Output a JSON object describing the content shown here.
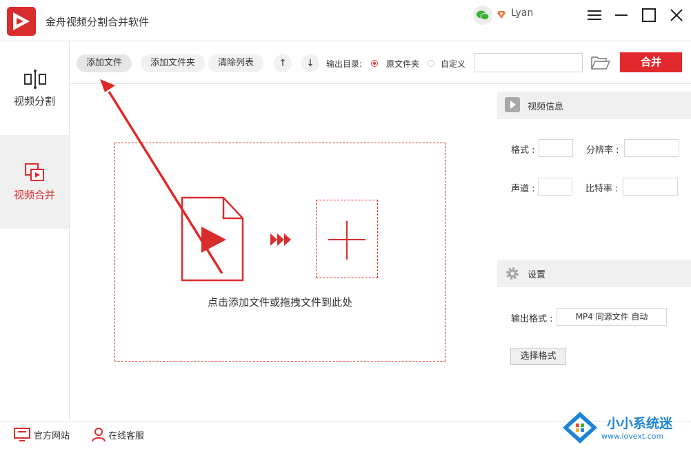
{
  "app": {
    "title": "金舟视频分割合并软件",
    "user": "Lyan",
    "accent": "#d92d2d"
  },
  "sidebar": {
    "items": [
      {
        "label": "视频分割",
        "icon": "split-icon",
        "active": false
      },
      {
        "label": "视频合并",
        "icon": "merge-icon",
        "active": true
      }
    ]
  },
  "toolbar": {
    "add_file": "添加文件",
    "add_folder": "添加文件夹",
    "clear_list": "清除列表",
    "output_dir_label": "输出目录:",
    "radio_source": "原文件夹",
    "radio_custom": "自定义",
    "path_value": "",
    "merge_button": "合并"
  },
  "dropzone": {
    "hint": "点击添加文件或拖拽文件到此处"
  },
  "video_info": {
    "header": "视频信息",
    "format_label": "格式 :",
    "resolution_label": "分辨率 :",
    "channel_label": "声道 :",
    "bitrate_label": "比特率 :",
    "format_value": "",
    "resolution_value": "",
    "channel_value": "",
    "bitrate_value": ""
  },
  "settings": {
    "header": "设置",
    "output_format_label": "输出格式 :",
    "output_format_value": "MP4 同源文件 自动",
    "choose_format": "选择格式"
  },
  "footer": {
    "website": "官方网站",
    "support": "在线客服"
  },
  "watermark": {
    "name": "小小系统迷",
    "url": "www.lovext.com"
  }
}
